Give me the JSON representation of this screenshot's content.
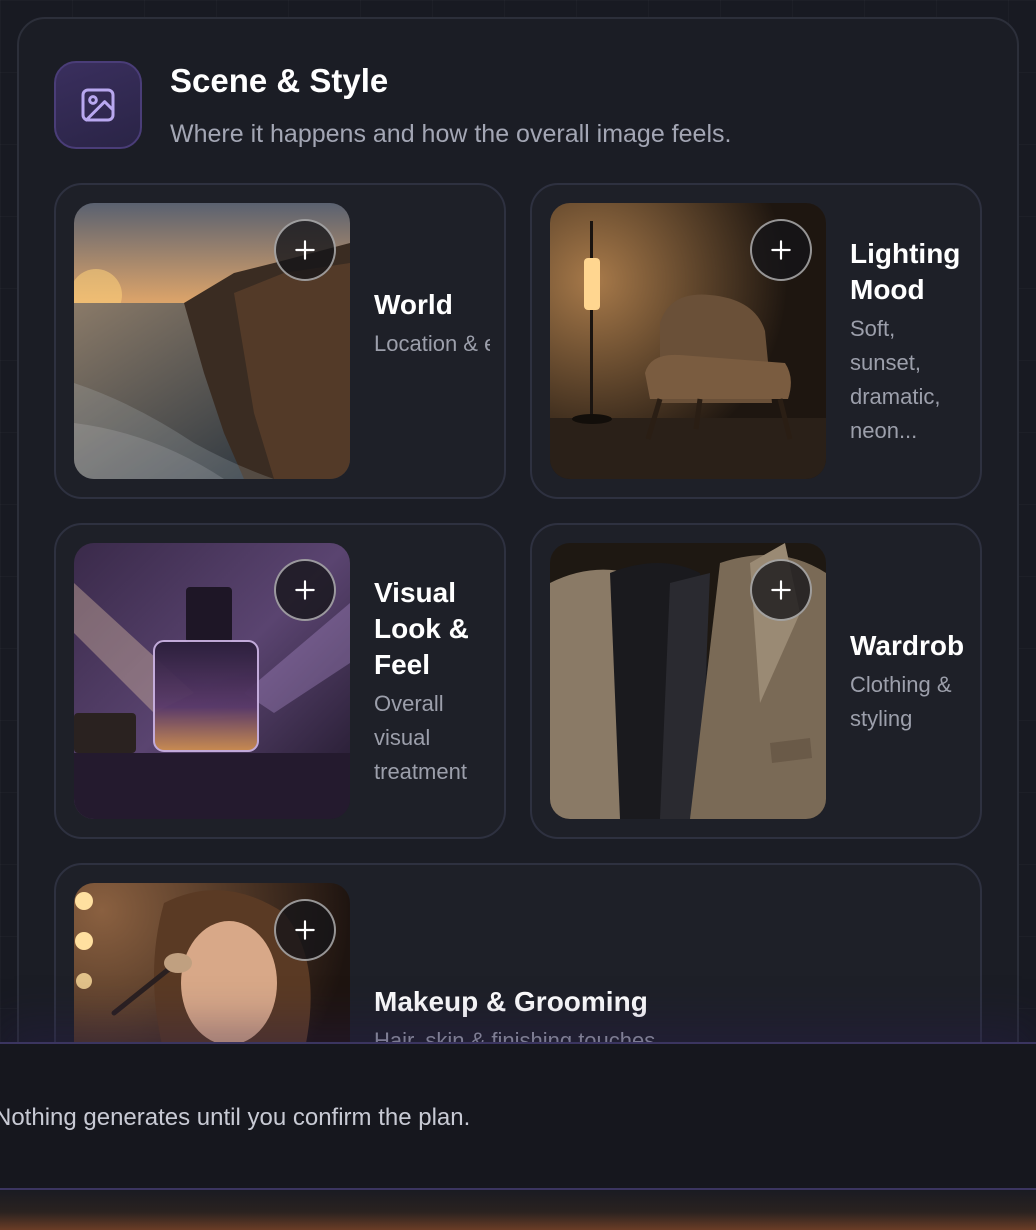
{
  "section": {
    "icon": "image-icon",
    "title": "Scene & Style",
    "subtitle": "Where it happens and how the overall image feels."
  },
  "cards": [
    {
      "title": "World",
      "description": "Location & environme",
      "image": "coastal-sunset-cliffs"
    },
    {
      "title": "Lighting Mood",
      "description": "Soft, sunset, dramatic, neon...",
      "image": "armchair-floor-lamp"
    },
    {
      "title": "Visual Look & Feel",
      "description": "Overall visual treatment",
      "image": "perfume-bottle"
    },
    {
      "title": "Wardrob",
      "description": "Clothing & styling",
      "image": "tweed-jackets"
    },
    {
      "title": "Makeup & Grooming",
      "description": "Hair, skin & finishing touches",
      "image": "woman-applying-makeup"
    }
  ],
  "add_button_icon": "plus-icon",
  "footer": {
    "note": "Nothing generates until you confirm the plan."
  },
  "colors": {
    "background": "#181a22",
    "card": "#1e2028",
    "accent": "#4a3d78"
  }
}
